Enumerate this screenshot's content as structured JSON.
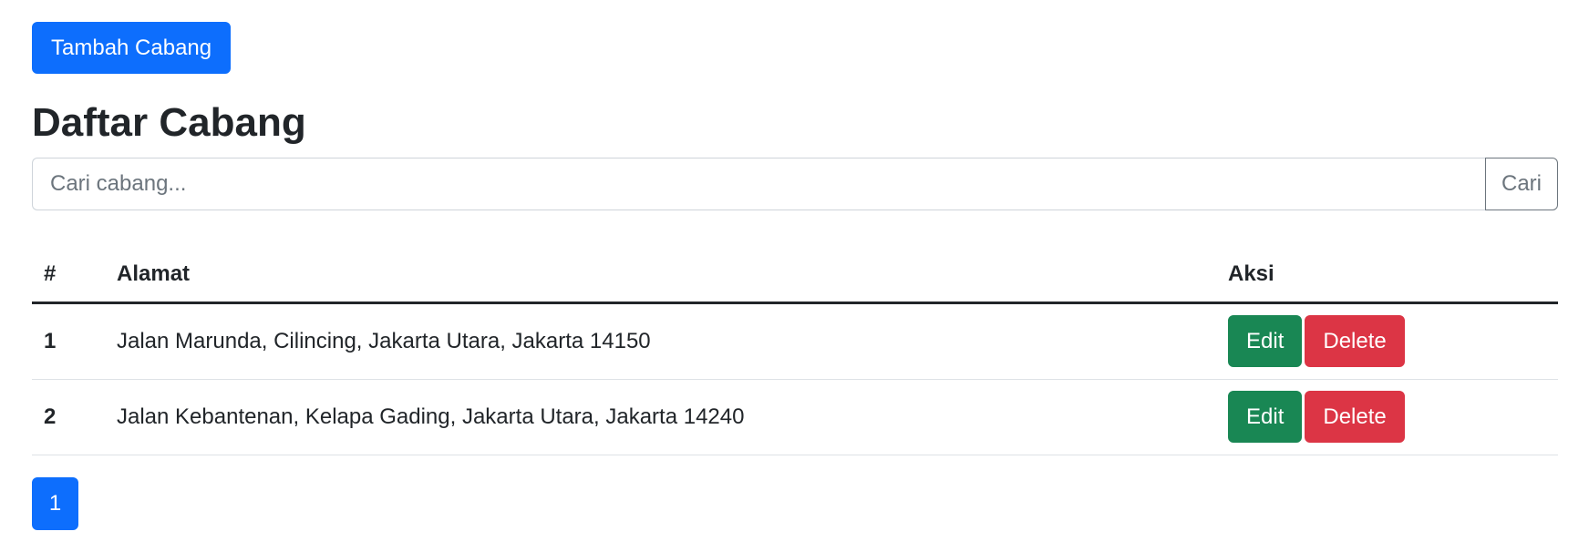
{
  "toolbar": {
    "add_label": "Tambah Cabang"
  },
  "page": {
    "title": "Daftar Cabang"
  },
  "search": {
    "placeholder": "Cari cabang...",
    "value": "",
    "button_label": "Cari"
  },
  "table": {
    "headers": [
      "#",
      "Alamat",
      "Aksi"
    ],
    "rows": [
      {
        "number": "1",
        "address": "Jalan Marunda, Cilincing, Jakarta Utara, Jakarta 14150",
        "edit_label": "Edit",
        "delete_label": "Delete"
      },
      {
        "number": "2",
        "address": "Jalan Kebantenan, Kelapa Gading, Jakarta Utara, Jakarta 14240",
        "edit_label": "Edit",
        "delete_label": "Delete"
      }
    ]
  },
  "pagination": {
    "pages": [
      "1"
    ],
    "active": "1"
  },
  "colors": {
    "primary": "#0d6efd",
    "success": "#198754",
    "danger": "#dc3545",
    "secondary": "#6c757d"
  }
}
